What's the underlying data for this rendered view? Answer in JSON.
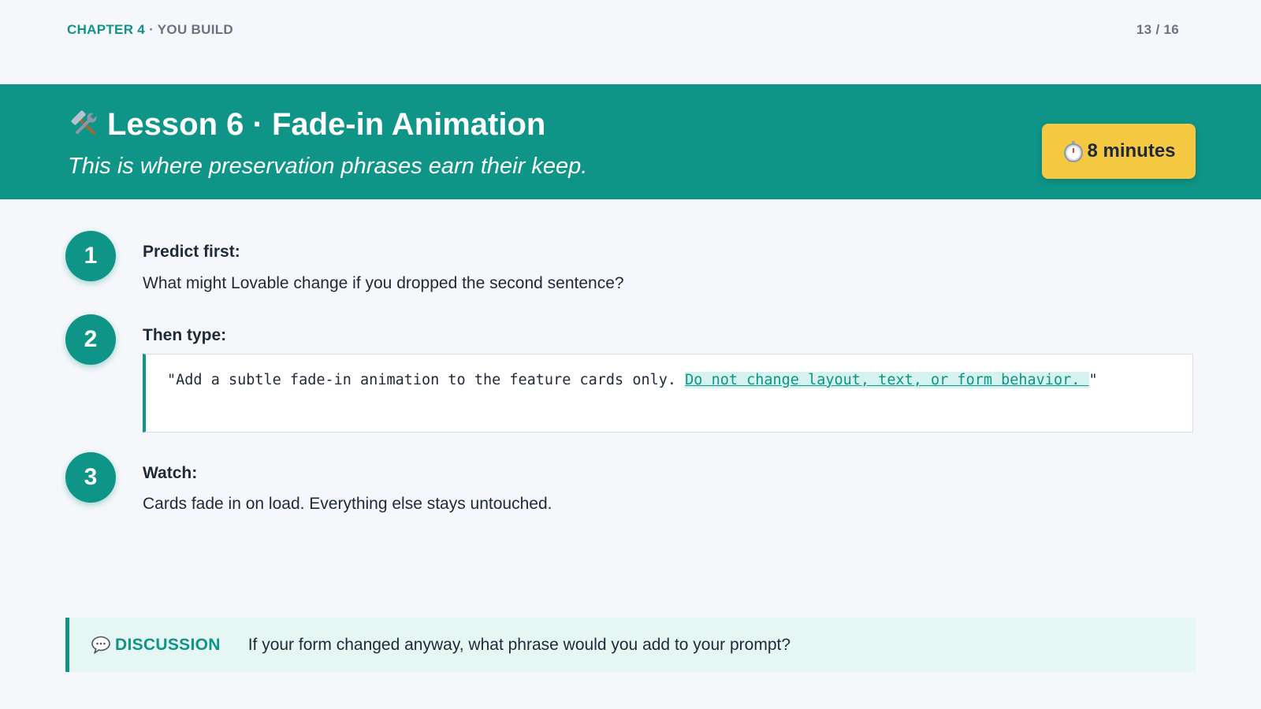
{
  "header": {
    "chapter": "CHAPTER 4",
    "separator": "·",
    "section": "YOU BUILD",
    "page_counter": "13 / 16"
  },
  "banner": {
    "icon": "hammer-and-wrench-icon",
    "title": "Lesson 6 · Fade-in Animation",
    "subtitle": "This is where preservation phrases earn their keep.",
    "timer_icon": "stopwatch-icon",
    "timer_label": "8 minutes"
  },
  "steps": [
    {
      "number": "1",
      "label": "Predict first:",
      "text": "What might Lovable change if you dropped the second sentence?"
    },
    {
      "number": "2",
      "label": "Then type:",
      "code_open_quote": "\"",
      "code_plain": "Add a subtle fade-in animation to the feature cards only. ",
      "code_highlight": "Do not change layout, text, or form behavior. ",
      "code_close_quote": "\""
    },
    {
      "number": "3",
      "label": "Watch:",
      "text": "Cards fade in on load. Everything else stays untouched."
    }
  ],
  "discussion": {
    "icon": "speech-bubble-icon",
    "label": "DISCUSSION",
    "text": "If your form changed anyway, what phrase would you add to your prompt?"
  },
  "colors": {
    "accent": "#0f9488",
    "badge": "#f5c842",
    "background": "#f5f7fa",
    "discussion_bg": "#e6f6f3"
  }
}
